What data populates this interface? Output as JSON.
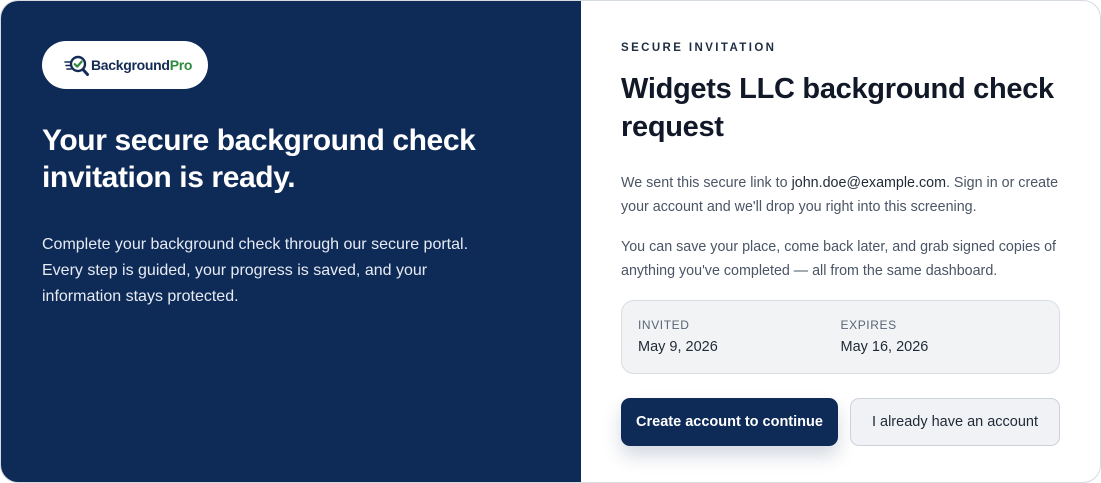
{
  "brand": {
    "logo_part1": "Background",
    "logo_part2": "Pro",
    "navy": "#0e2a57",
    "green": "#2e8b3d"
  },
  "left": {
    "headline": "Your secure background check invitation is ready.",
    "body": "Complete your background check through our secure portal. Every step is guided, your progress is saved, and your information stays protected."
  },
  "right": {
    "eyebrow": "SECURE INVITATION",
    "title": "Widgets LLC background check request",
    "para1_before": "We sent this secure link to ",
    "para1_email": "john.doe@example.com",
    "para1_after": ". Sign in or create your account and we'll drop you right into this screening.",
    "para2": "You can save your place, come back later, and grab signed copies of anything you've completed — all from the same dashboard."
  },
  "dates": {
    "invited_label": "INVITED",
    "invited_value": "May 9, 2026",
    "expires_label": "EXPIRES",
    "expires_value": "May 16, 2026"
  },
  "actions": {
    "primary_label": "Create account to continue",
    "secondary_label": "I already have an account"
  }
}
